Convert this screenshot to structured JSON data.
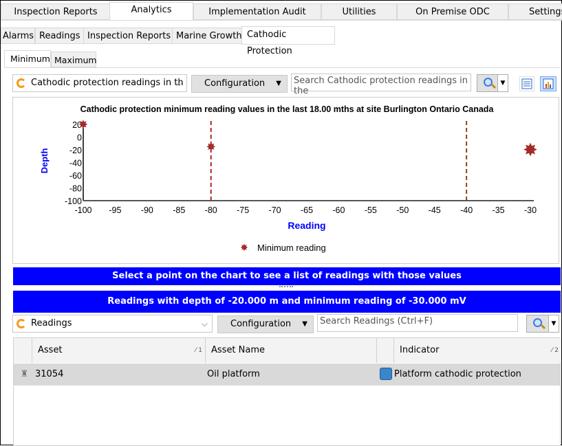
{
  "top_tabs": [
    "Inspection Reports",
    "Analytics",
    "Implementation Audit",
    "Utilities",
    "On Premise ODC",
    "Settings"
  ],
  "sub_tabs": [
    "Alarms",
    "Readings",
    "Inspection Reports",
    "Marine Growth",
    "Cathodic Protection"
  ],
  "mode_tabs": [
    "Minimum",
    "Maximum"
  ],
  "toolbar": {
    "view_value": "Cathodic protection readings in th",
    "config_label": "Configuration",
    "search_placeholder": "Search Cathodic protection readings in the"
  },
  "chart_data": {
    "type": "scatter",
    "title": "Cathodic protection minimum reading values in the last 18.00 mths at site Burlington Ontario Canada",
    "xlabel": "Reading",
    "ylabel": "Depth",
    "xlim": [
      -100,
      -30
    ],
    "ylim": [
      -100,
      20
    ],
    "xticks": [
      "-100",
      "-95",
      "-90",
      "-85",
      "-80",
      "-75",
      "-70",
      "-65",
      "-60",
      "-55",
      "-50",
      "-45",
      "-40",
      "-35",
      "-30"
    ],
    "yticks": [
      "20",
      "0",
      "-20",
      "-40",
      "-60",
      "-80",
      "-100"
    ],
    "series": [
      {
        "name": "Minimum reading",
        "color": "#a52a2a",
        "points": [
          {
            "x": -100,
            "y": 20
          },
          {
            "x": -80,
            "y": -15
          },
          {
            "x": -30,
            "y": -20,
            "selected": true
          }
        ]
      }
    ],
    "reference_lines": [
      {
        "x": -80,
        "color": "#b22222"
      },
      {
        "x": -40,
        "color": "#8b4513"
      }
    ],
    "legend": "bottom-center"
  },
  "hint_bar": "Select a point on the chart to see a list of readings with those values",
  "selection_bar": "Readings with depth of -20.000 m and minimum reading of -30.000 mV",
  "readings_toolbar": {
    "view_value": "Readings",
    "config_label": "Configuration",
    "search_placeholder": "Search Readings  (Ctrl+F)"
  },
  "table": {
    "columns": [
      "Asset",
      "Asset Name",
      "Indicator"
    ],
    "sort_marks": [
      "1",
      "2"
    ],
    "rows": [
      {
        "asset": "31054",
        "asset_name": "Oil platform",
        "indicator": "Platform cathodic protection"
      }
    ]
  }
}
